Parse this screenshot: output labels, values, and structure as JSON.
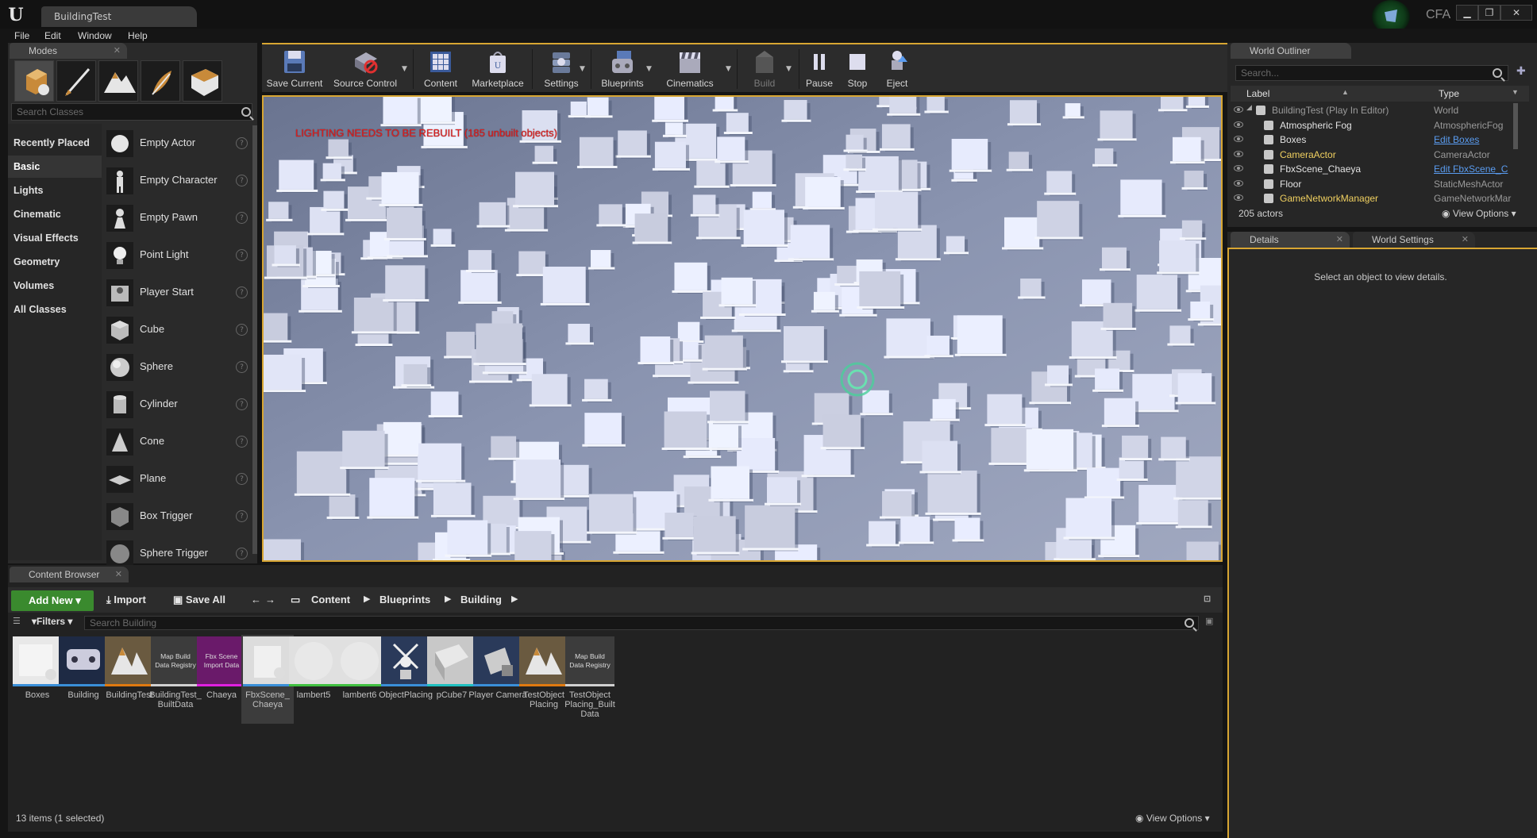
{
  "window": {
    "tab_title": "BuildingTest",
    "user_badge": "CFA",
    "controls": {
      "minimize": "▁",
      "maximize": "❐",
      "close": "✕"
    }
  },
  "menu": [
    "File",
    "Edit",
    "Window",
    "Help"
  ],
  "modes": {
    "tab": "Modes",
    "search_placeholder": "Search Classes",
    "categories": [
      "Recently Placed",
      "Basic",
      "Lights",
      "Cinematic",
      "Visual Effects",
      "Geometry",
      "Volumes",
      "All Classes"
    ],
    "active_category": "Basic",
    "classes": [
      "Empty Actor",
      "Empty Character",
      "Empty Pawn",
      "Point Light",
      "Player Start",
      "Cube",
      "Sphere",
      "Cylinder",
      "Cone",
      "Plane",
      "Box Trigger",
      "Sphere Trigger"
    ],
    "help_glyph": "?"
  },
  "toolbar": {
    "items": [
      "Save Current",
      "Source Control",
      "Content",
      "Marketplace",
      "Settings",
      "Blueprints",
      "Cinematics",
      "Build",
      "Pause",
      "Stop",
      "Eject"
    ],
    "disabled": [
      "Build"
    ]
  },
  "viewport": {
    "warning": "LIGHTING NEEDS TO BE REBUILT (185 unbuilt objects)"
  },
  "outliner": {
    "tab": "World Outliner",
    "search_placeholder": "Search...",
    "col_label": "Label",
    "col_type": "Type",
    "rows": [
      {
        "label": "BuildingTest (Play In Editor)",
        "type": "World",
        "type_link": false
      },
      {
        "label": "Atmospheric Fog",
        "type": "AtmosphericFog",
        "type_link": false
      },
      {
        "label": "Boxes",
        "type": "Edit Boxes",
        "type_link": true
      },
      {
        "label": "CameraActor",
        "type": "CameraActor",
        "type_link": false
      },
      {
        "label": "FbxScene_Chaeya",
        "type": "Edit FbxScene_C",
        "type_link": true
      },
      {
        "label": "Floor",
        "type": "StaticMeshActor",
        "type_link": false
      },
      {
        "label": "GameNetworkManager",
        "type": "GameNetworkMar",
        "type_link": false
      }
    ],
    "actor_count": "205 actors",
    "view_options": "View Options"
  },
  "details": {
    "tab": "Details",
    "tab2": "World Settings",
    "empty_message": "Select an object to view details."
  },
  "content_browser": {
    "tab": "Content Browser",
    "add_new": "Add New",
    "import": "Import",
    "save_all": "Save All",
    "breadcrumb": [
      "Content",
      "Blueprints",
      "Building"
    ],
    "filters": "Filters",
    "search_placeholder": "Search Building",
    "assets": [
      {
        "label": "Boxes",
        "thumb_text": "",
        "bar": "#3a8fd8"
      },
      {
        "label": "Building",
        "thumb_text": "",
        "bar": "#3a8fd8"
      },
      {
        "label": "BuildingTest",
        "thumb_text": "",
        "bar": "#e07a10"
      },
      {
        "label": "BuildingTest_ BuiltData",
        "thumb_text": "Map Build Data Registry",
        "bar": "#d0d0d0"
      },
      {
        "label": "Chaeya",
        "thumb_text": "Fbx Scene Import Data",
        "bar": "#e020e0"
      },
      {
        "label": "FbxScene_ Chaeya",
        "thumb_text": "",
        "bar": "#3a8fd8"
      },
      {
        "label": "lambert5",
        "thumb_text": "",
        "bar": "#40c040"
      },
      {
        "label": "lambert6",
        "thumb_text": "",
        "bar": "#40c040"
      },
      {
        "label": "ObjectPlacing",
        "thumb_text": "",
        "bar": "#3a8fd8"
      },
      {
        "label": "pCube7",
        "thumb_text": "",
        "bar": "#20c0c0"
      },
      {
        "label": "Player Camera",
        "thumb_text": "",
        "bar": "#3a8fd8"
      },
      {
        "label": "TestObject Placing",
        "thumb_text": "",
        "bar": "#e07a10"
      },
      {
        "label": "TestObject Placing_Built Data",
        "thumb_text": "Map Build Data Registry",
        "bar": "#d0d0d0"
      }
    ],
    "selected_index": 5,
    "status": "13 items (1 selected)",
    "view_options": "View Options"
  },
  "colors": {
    "accent_gold": "#d8a632",
    "add_new_green": "#3a8a2e",
    "link_blue": "#5a9cf0",
    "warning_red": "#e02020"
  }
}
